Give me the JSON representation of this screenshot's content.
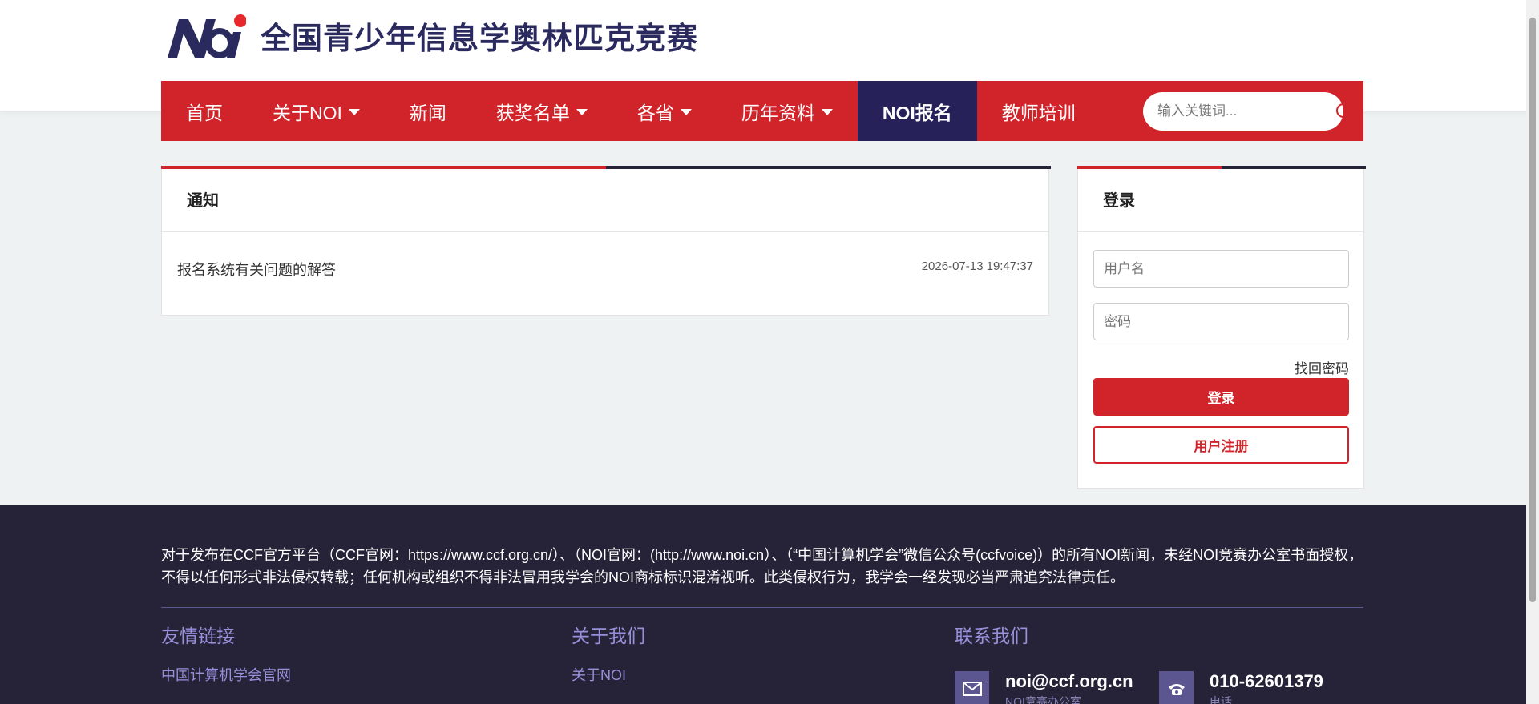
{
  "header": {
    "title": "全国青少年信息学奥林匹克竞赛",
    "brand_colors": {
      "navy": "#2b2a5f",
      "red": "#e8262b"
    }
  },
  "nav": {
    "items": [
      {
        "label": "首页",
        "dropdown": false
      },
      {
        "label": "关于NOI",
        "dropdown": true
      },
      {
        "label": "新闻",
        "dropdown": false
      },
      {
        "label": "获奖名单",
        "dropdown": true
      },
      {
        "label": "各省",
        "dropdown": true
      },
      {
        "label": "历年资料",
        "dropdown": true
      },
      {
        "label": "NOI报名",
        "dropdown": false,
        "active": true
      },
      {
        "label": "教师培训",
        "dropdown": false
      }
    ],
    "search_placeholder": "输入关键词...",
    "search_icon": "search-icon",
    "colors": {
      "bar": "#d0242a",
      "active": "#262259"
    }
  },
  "notice": {
    "title": "通知",
    "items": [
      {
        "title": "报名系统有关问题的解答",
        "time": "2026-07-13 19:47:37"
      }
    ]
  },
  "login": {
    "title": "登录",
    "username_placeholder": "用户名",
    "password_placeholder": "密码",
    "forgot_label": "找回密码",
    "login_label": "登录",
    "register_label": "用户注册"
  },
  "footer": {
    "notice_text": "对于发布在CCF官方平台（CCF官网：https://www.ccf.org.cn/）、（NOI官网：(http://www.noi.cn）、（“中国计算机学会”微信公众号(ccfvoice)）的所有NOI新闻，未经NOI竞赛办公室书面授权，不得以任何形式非法侵权转载；任何机构或组织不得非法冒用我学会的NOI商标标识混淆视听。此类侵权行为，我学会一经发现必当严肃追究法律责任。",
    "columns": [
      {
        "title": "友情链接",
        "links": [
          "中国计算机学会官网"
        ]
      },
      {
        "title": "关于我们",
        "links": [
          "关于NOI"
        ]
      },
      {
        "title": "联系我们"
      }
    ],
    "contacts": [
      {
        "value": "noi@ccf.org.cn",
        "label": "NOI竞赛办公室",
        "icon": "mail-icon"
      },
      {
        "value": "010-62601379",
        "label": "电话",
        "icon": "phone-icon"
      }
    ],
    "colors": {
      "background": "#262338",
      "accent": "#9890db"
    }
  }
}
